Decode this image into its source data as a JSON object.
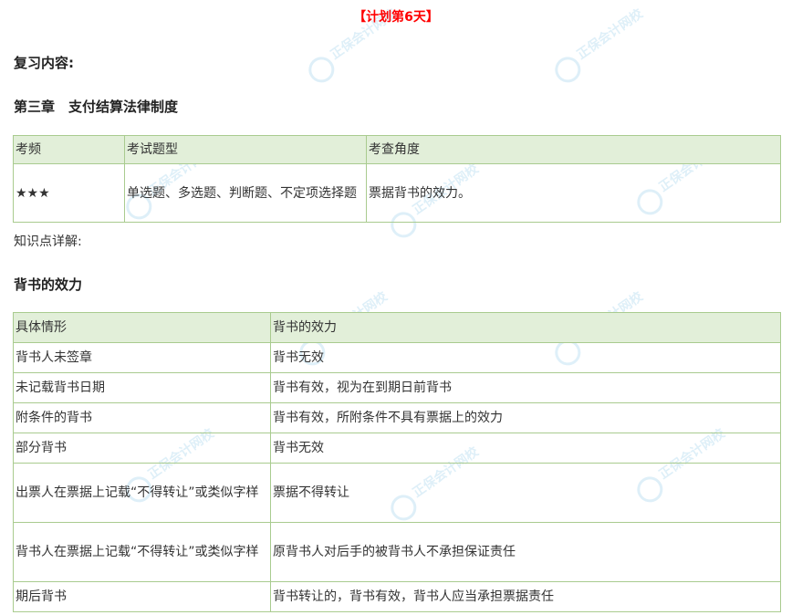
{
  "plan_title": "【计划第6天】",
  "review_label": "复习内容:",
  "chapter_title": "第三章　支付结算法律制度",
  "table1": {
    "headers": [
      "考频",
      "考试题型",
      "考查角度"
    ],
    "row": [
      "★★★",
      "单选题、多选题、判断题、不定项选择题",
      "票据背书的效力。"
    ]
  },
  "knowledge_label": "知识点详解:",
  "section_title": "背书的效力",
  "table2": {
    "headers": [
      "具体情形",
      "背书的效力"
    ],
    "rows": [
      [
        "背书人未签章",
        "背书无效"
      ],
      [
        "未记载背书日期",
        "背书有效，视为在到期日前背书"
      ],
      [
        "附条件的背书",
        "背书有效，所附条件不具有票据上的效力"
      ],
      [
        "部分背书",
        "背书无效"
      ],
      [
        "出票人在票据上记载“不得转让”或类似字样",
        "票据不得转让"
      ],
      [
        "背书人在票据上记载“不得转让”或类似字样",
        "原背书人对后手的被背书人不承担保证责任"
      ],
      [
        "期后背书",
        "背书转让的，背书有效，背书人应当承担票据责任"
      ]
    ]
  },
  "watermark": {
    "text": "正保会计网校",
    "icon": "zhengbao-logo-icon",
    "color": "#3aa3d8"
  }
}
